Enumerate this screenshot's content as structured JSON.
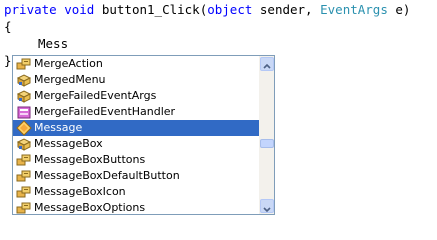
{
  "code": {
    "line1": {
      "kw_private": "private",
      "kw_void": "void",
      "method": "button1_Click(",
      "kw_object": "object",
      "param1": "sender,",
      "type_eventargs": "EventArgs",
      "param2": "e)"
    },
    "line2": "{",
    "line3": "Mess",
    "line4": "}"
  },
  "completion": {
    "items": [
      {
        "label": "MergeAction",
        "icon": "enum-icon"
      },
      {
        "label": "MergedMenu",
        "icon": "class-icon"
      },
      {
        "label": "MergeFailedEventArgs",
        "icon": "class-icon"
      },
      {
        "label": "MergeFailedEventHandler",
        "icon": "delegate-icon"
      },
      {
        "label": "Message",
        "icon": "struct-icon",
        "selected": true
      },
      {
        "label": "MessageBox",
        "icon": "class-icon"
      },
      {
        "label": "MessageBoxButtons",
        "icon": "enum-icon"
      },
      {
        "label": "MessageBoxDefaultButton",
        "icon": "enum-icon"
      },
      {
        "label": "MessageBoxIcon",
        "icon": "enum-icon"
      },
      {
        "label": "MessageBoxOptions",
        "icon": "enum-icon"
      }
    ],
    "scrollbar": {
      "up_icon": "chevron-up-icon",
      "down_icon": "chevron-down-icon"
    }
  },
  "colors": {
    "keyword": "#0000ff",
    "type": "#2b91af",
    "selection": "#316ac5"
  }
}
